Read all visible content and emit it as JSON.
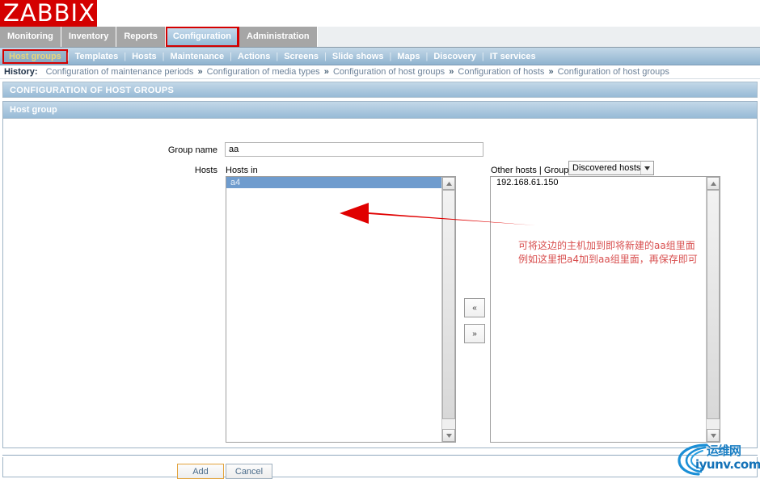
{
  "brand": {
    "logo_text": "ZABBIX",
    "logo_bg": "#d40000"
  },
  "main_menu": {
    "items": [
      {
        "label": "Monitoring",
        "selected": false
      },
      {
        "label": "Inventory",
        "selected": false
      },
      {
        "label": "Reports",
        "selected": false
      },
      {
        "label": "Configuration",
        "selected": true,
        "highlighted": true
      },
      {
        "label": "Administration",
        "selected": false
      }
    ]
  },
  "sub_menu": {
    "items": [
      {
        "label": "Host groups",
        "active": true
      },
      {
        "label": "Templates",
        "active": false
      },
      {
        "label": "Hosts",
        "active": false
      },
      {
        "label": "Maintenance",
        "active": false
      },
      {
        "label": "Actions",
        "active": false
      },
      {
        "label": "Screens",
        "active": false
      },
      {
        "label": "Slide shows",
        "active": false
      },
      {
        "label": "Maps",
        "active": false
      },
      {
        "label": "Discovery",
        "active": false
      },
      {
        "label": "IT services",
        "active": false
      }
    ]
  },
  "history": {
    "label": "History:",
    "entries": [
      "Configuration of maintenance periods",
      "Configuration of media types",
      "Configuration of host groups",
      "Configuration of hosts",
      "Configuration of host groups"
    ],
    "separator": "»"
  },
  "page": {
    "title": "CONFIGURATION OF HOST GROUPS"
  },
  "form": {
    "header": "Host group",
    "group_name_label": "Group name",
    "group_name_value": "aa",
    "group_name_placeholder": "",
    "hosts_label": "Hosts",
    "hosts_in_caption": "Hosts in",
    "other_hosts_caption": "Other hosts | Group",
    "group_select_value": "Discovered hosts",
    "hosts_in": [
      {
        "label": "a4",
        "selected": true
      }
    ],
    "other_hosts": [
      {
        "label": "192.168.61.150",
        "selected": false
      }
    ],
    "move_left_label": "«",
    "move_right_label": "»"
  },
  "footer": {
    "add_label": "Add",
    "cancel_label": "Cancel"
  },
  "annotation": {
    "line1": "可将这边的主机加到即将新建的aa组里面",
    "line2": "例如这里把a4加到aa组里面，再保存即可",
    "color": "#d84f4f",
    "arrow_color": "#e00000"
  },
  "watermark": {
    "text_cn": "运维网",
    "text_en": "iyunv.com",
    "color": "#1472b8"
  }
}
